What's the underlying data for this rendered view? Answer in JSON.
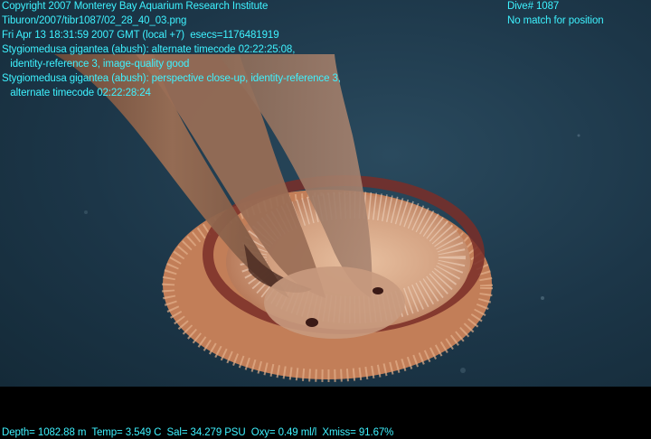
{
  "overlay": {
    "line1": "Copyright 2007 Monterey Bay Aquarium Research Institute",
    "line2": "Tiburon/2007/tibr1087/02_28_40_03.png",
    "line3": "Fri Apr 13 18:31:59 2007 GMT (local +7)  esecs=1176481919",
    "line4": "Stygiomedusa gigantea (abush): alternate timecode 02:22:25:08,",
    "line5": "   identity-reference 3, image-quality good",
    "line6": "Stygiomedusa gigantea (abush): perspective close-up, identity-reference 3,",
    "line7": "   alternate timecode 02:22:28:24"
  },
  "overlay_right": {
    "dive": "Dive# 1087",
    "position": "No match for position"
  },
  "telemetry": "Depth= 1082.88 m  Temp= 3.549 C  Sal= 34.279 PSU  Oxy= 0.49 ml/l  Xmiss= 91.67%",
  "colors": {
    "overlay_text": "#3ef2ff",
    "water": "#1c3648",
    "bell_rim": "#c27e58",
    "bell_band": "#7a2e28",
    "arms": "#8a5e44"
  }
}
